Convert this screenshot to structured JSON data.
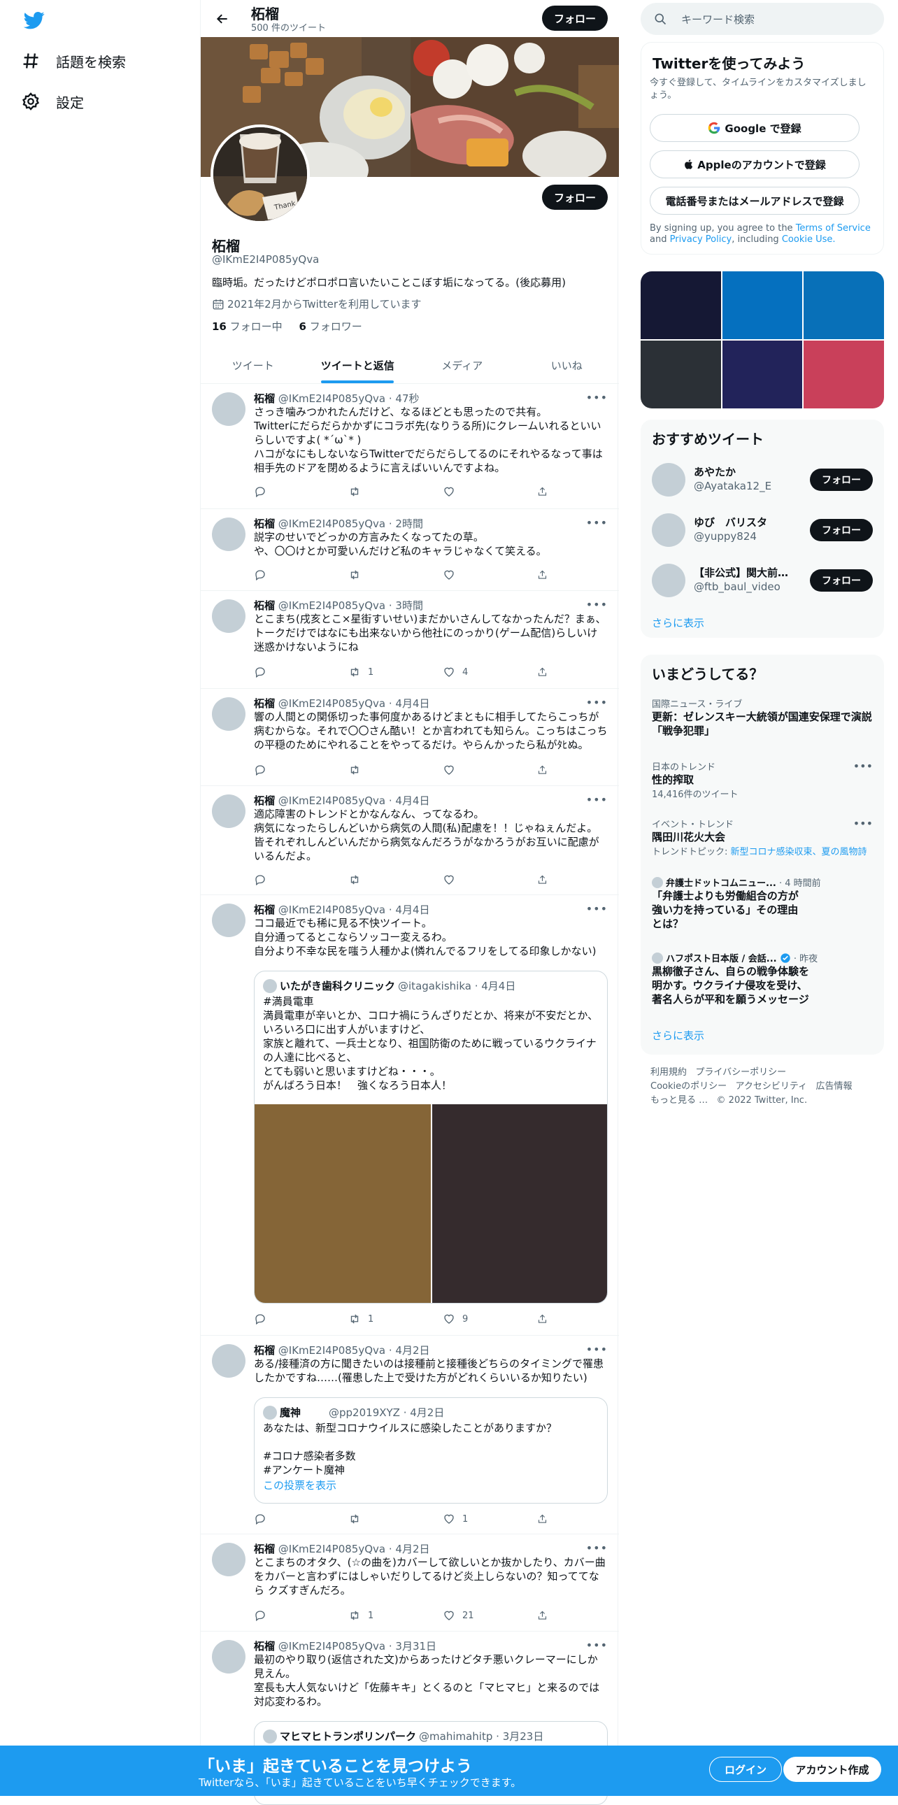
{
  "nav": {
    "explore": "話題を検索",
    "settings": "設定"
  },
  "header": {
    "name": "柘榴",
    "tweet_count": "500 件のツイート",
    "follow": "フォロー"
  },
  "profile": {
    "name": "柘榴",
    "handle": "@IKmE2I4P085yQva",
    "bio": "臨時垢。だったけどポロポロ言いたいことこぼす垢になってる。(後応募用)",
    "joined": "2021年2月からTwitterを利用しています",
    "following_count": "16",
    "following_label": "フォロー中",
    "followers_count": "6",
    "followers_label": "フォロワー",
    "follow": "フォロー"
  },
  "tabs": [
    "ツイート",
    "ツイートと返信",
    "メディア",
    "いいね"
  ],
  "tweets": [
    {
      "name": "柘榴",
      "handle": "@IKmE2I4P085yQva",
      "time": "47秒",
      "text": "さっき噛みつかれたんだけど、なるほどとも思ったので共有。\nTwitterにだらだらかかずにコラボ先(なりうる所)にクレームいれるといいらしいですよ( *´ω`* )\nハコがなにもしないならTwitterでだらだらしてるのにそれやるなって事は相手先のドアを閉めるように言えばいいんですよね。",
      "retweets": "",
      "likes": ""
    },
    {
      "name": "柘榴",
      "handle": "@IKmE2I4P085yQva",
      "time": "2時間",
      "text": "説字のせいでどっかの方言みたくなってたの草。\nや、〇〇けとか可愛いんだけど私のキャラじゃなくて笑える。",
      "retweets": "",
      "likes": ""
    },
    {
      "name": "柘榴",
      "handle": "@IKmE2I4P085yQva",
      "time": "3時間",
      "text": "とこまち(戌亥とこ×星街すいせい)まだかいさんしてなかったんだ？まぁ、トークだけではなにも出来ないから他社にのっかり(ゲーム配信)らしいけ迷惑かけないようにね",
      "retweets": "1",
      "likes": "4"
    },
    {
      "name": "柘榴",
      "handle": "@IKmE2I4P085yQva",
      "time": "4月4日",
      "text": "響の人間との関係切った事何度かあるけどまともに相手してたらこっちが病むからな。それで〇〇さん酷い！とか言われても知らん。こっちはこっちの平穏のためにやれることをやってるだけ。やらんかったら私がﾀﾋぬ。",
      "retweets": "",
      "likes": ""
    },
    {
      "name": "柘榴",
      "handle": "@IKmE2I4P085yQva",
      "time": "4月4日",
      "text": "適応障害のトレンドとかなんなん、ってなるわ。\n病気になったらしんどいから病気の人間(私)配慮を！！じゃねぇんだよ。\n皆それぞれしんどいんだから病気なんだろうがなかろうがお互いに配慮がいるんだよ。",
      "retweets": "",
      "likes": ""
    },
    {
      "name": "柘榴",
      "handle": "@IKmE2I4P085yQva",
      "time": "4月4日",
      "text": "ココ最近でも稀に見る不快ツイート。\n自分通ってるとこならソッコー変えるわ。\n自分より不幸な民を嗤う人種かよ(憐れんでるフリをしてる印象しかない)",
      "retweets": "1",
      "likes": "9",
      "quote": {
        "name": "いたがき歯科クリニック",
        "handle": "@itagakishika",
        "time": "4月4日",
        "text": "#満員電車\n満員電車が辛いとか、コロナ禍にうんざりだとか、将来が不安だとか、いろいろ口に出す人がいますけど、\n家族と離れて、一兵士となり、祖国防衛のために戦っているウクライナの人達に比べると、\nとても弱いと思いますけどね・・・。\nがんばろう日本！　強くなろう日本人！"
      }
    },
    {
      "name": "柘榴",
      "handle": "@IKmE2I4P085yQva",
      "time": "4月2日",
      "text": "ある/接種済の方に聞きたいのは接種前と接種後どちらのタイミングで罹患したかですね……(罹患した上で受けた方がどれくらいいるか知りたい)",
      "retweets": "",
      "likes": "1",
      "quote": {
        "name": "魔神",
        "handle": "@pp2019XYZ",
        "time": "4月2日",
        "text": "あなたは、新型コロナウイルスに感染したことがありますか？\n\n#コロナ感染者多数\n#アンケート魔神",
        "link": "この投票を表示"
      }
    },
    {
      "name": "柘榴",
      "handle": "@IKmE2I4P085yQva",
      "time": "4月2日",
      "text": "とこまちのオタク、(☆の曲を)カバーして欲しいとか抜かしたり、カバー曲をカバーと言わずにはしゃいだりしてるけど炎上しらないの？知っててなら クズすぎんだろ。",
      "retweets": "1",
      "likes": "21"
    },
    {
      "name": "柘榴",
      "handle": "@IKmE2I4P085yQva",
      "time": "3月31日",
      "text": "最初のやり取り(返信された文)からあったけどタチ悪いクレーマーにしか見えん。\n室長も大人気ないけど「佐藤キキ」とくるのと「マヒマヒ」と来るのでは対応変わるわ。",
      "quote": {
        "name": "マヒマヒトランポリンパーク",
        "handle": "@mahimahitp",
        "time": "3月23日"
      }
    }
  ],
  "search": {
    "placeholder": "キーワード検索"
  },
  "signup": {
    "title": "Twitterを使ってみよう",
    "subtitle": "今すぐ登録して、タイムラインをカスタマイズしましょう。",
    "google": "Google で登録",
    "apple": "Appleのアカウントで登録",
    "phone": "電話番号またはメールアドレスで登録",
    "terms_pre": "By signing up, you agree to the",
    "terms": "Terms of Service",
    "and": "and",
    "privacy": "Privacy Policy",
    "including": ", including",
    "cookie": "Cookie Use."
  },
  "media_colors": [
    "#151834",
    "#0570bf",
    "#0870b8",
    "#2b3036",
    "#22235a",
    "#c9405a"
  ],
  "recommended": {
    "title": "おすすめツイート",
    "users": [
      {
        "name": "あやたか",
        "handle": "@Ayataka12_E"
      },
      {
        "name": "ゆび　バリスタ",
        "handle": "@yuppy824"
      },
      {
        "name": "【非公式】関大前フ...",
        "handle": "@ftb_baul_video"
      }
    ],
    "follow": "フォロー",
    "more": "さらに表示"
  },
  "trends": {
    "title": "いまどうしてる？",
    "items": [
      {
        "cat": "国際ニュース・ライブ",
        "title": "更新：ゼレンスキー大統領が国連安保理で演説 「戦争犯罪」"
      },
      {
        "cat": "日本のトレンド",
        "title": "性的搾取",
        "sub": "14,416件のツイート"
      },
      {
        "cat": "イベント・トレンド",
        "title": "隅田川花火大会",
        "sub_pre": "トレンドトピック: ",
        "sub": "新型コロナ感染収束、夏の風物詩"
      },
      {
        "cat": "弁護士ドットコムニュー...",
        "time": "· 4 時間前",
        "title": "「弁護士よりも労働組合の方が強い力を持っている」その理由とは？"
      },
      {
        "cat": "ハフポスト日本版 / 会話...",
        "time": "· 昨夜",
        "title": "黒柳徹子さん、自らの戦争体験を明かす。ウクライナ侵攻を受け、著名人らが平和を願うメッセージ"
      }
    ],
    "more": "さらに表示"
  },
  "footer": {
    "links": [
      "利用規約",
      "プライバシーポリシー",
      "Cookieのポリシー",
      "アクセシビリティ",
      "広告情報",
      "もっと見る …"
    ],
    "copyright": "© 2022 Twitter, Inc."
  },
  "bottom": {
    "title": "「いま」起きていることを見つけよう",
    "subtitle": "Twitterなら、「いま」起きていることをいち早くチェックできます。",
    "login": "ログイン",
    "signup": "アカウント作成"
  }
}
